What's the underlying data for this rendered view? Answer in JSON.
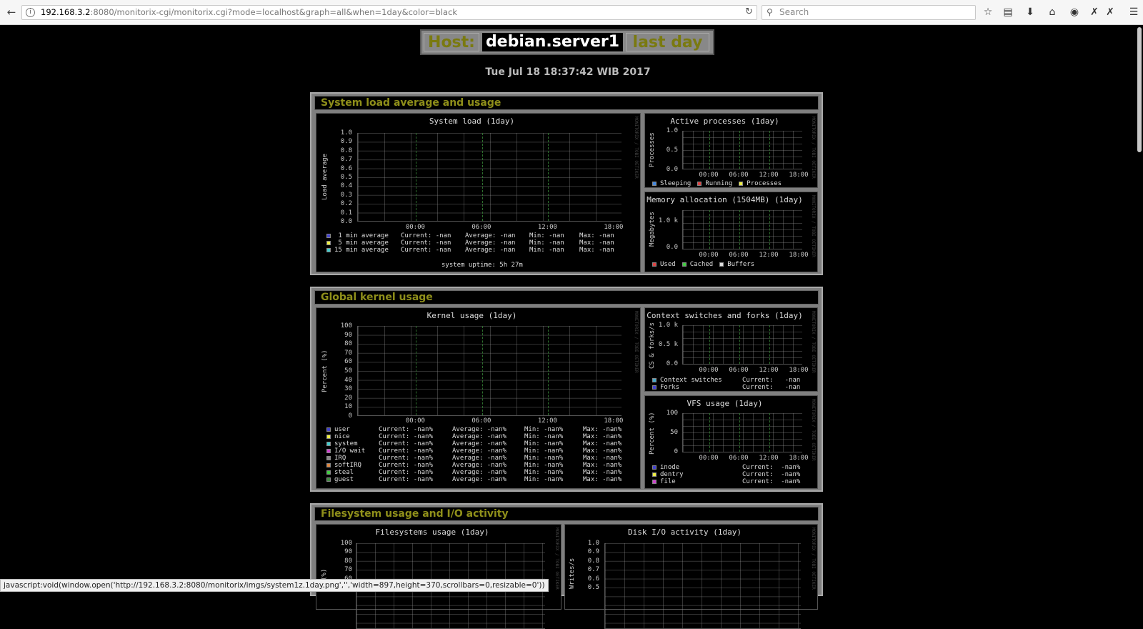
{
  "browser": {
    "url_host": "192.168.3.2",
    "url_rest": ":8080/monitorix-cgi/monitorix.cgi?mode=localhost&graph=all&when=1day&color=black",
    "search_placeholder": "Search"
  },
  "header": {
    "host_label": "Host:",
    "host_name": "debian.server1",
    "period": "last day",
    "datetime": "Tue Jul 18 18:37:42 WIB 2017"
  },
  "sections": [
    {
      "title": "System load average and usage"
    },
    {
      "title": "Global kernel usage"
    },
    {
      "title": "Filesystem usage and I/O activity"
    }
  ],
  "side_tag": "MONITORIX / TOBI OETIKER",
  "x_ticks": [
    "00:00",
    "06:00",
    "12:00",
    "18:00"
  ],
  "graphs": {
    "system_load": {
      "title": "System load  (1day)",
      "ylabel": "Load average",
      "yticks": [
        "1.0",
        "0.9",
        "0.8",
        "0.7",
        "0.6",
        "0.5",
        "0.4",
        "0.3",
        "0.2",
        "0.1",
        "0.0"
      ],
      "legend": [
        {
          "name": " 1 min average",
          "current": "Current: -nan",
          "average": "Average: -nan",
          "min": "Min: -nan",
          "max": "Max: -nan",
          "color": "#4444cc"
        },
        {
          "name": " 5 min average",
          "current": "Current: -nan",
          "average": "Average: -nan",
          "min": "Min: -nan",
          "max": "Max: -nan",
          "color": "#eeee44"
        },
        {
          "name": "15 min average",
          "current": "Current: -nan",
          "average": "Average: -nan",
          "min": "Min: -nan",
          "max": "Max: -nan",
          "color": "#44cccc"
        }
      ],
      "uptime": "system uptime:  5h 27m"
    },
    "active_processes": {
      "title": "Active processes  (1day)",
      "ylabel": "Processes",
      "yticks": [
        "1.0",
        "0.5",
        "0.0"
      ],
      "legend": [
        {
          "name": "Sleeping",
          "color": "#4488dd"
        },
        {
          "name": "Running",
          "color": "#dd4444"
        },
        {
          "name": "Processes",
          "color": "#eeee44"
        }
      ]
    },
    "memory": {
      "title": "Memory allocation (1504MB)  (1day)",
      "ylabel": "Megabytes",
      "yticks": [
        "1.0 k",
        "0.0"
      ],
      "legend": [
        {
          "name": "Used",
          "color": "#dd4444"
        },
        {
          "name": "Cached",
          "color": "#44cc44"
        },
        {
          "name": "Buffers",
          "color": "#dddddd"
        }
      ]
    },
    "kernel": {
      "title": "Kernel usage  (1day)",
      "ylabel": "Percent (%)",
      "yticks": [
        "100",
        "90",
        "80",
        "70",
        "60",
        "50",
        "40",
        "30",
        "20",
        "10",
        "0"
      ],
      "legend": [
        {
          "name": "user",
          "current": "Current: -nan%",
          "average": "Average: -nan%",
          "min": "Min: -nan%",
          "max": "Max: -nan%",
          "color": "#4444cc"
        },
        {
          "name": "nice",
          "current": "Current: -nan%",
          "average": "Average: -nan%",
          "min": "Min: -nan%",
          "max": "Max: -nan%",
          "color": "#eeee44"
        },
        {
          "name": "system",
          "current": "Current: -nan%",
          "average": "Average: -nan%",
          "min": "Min: -nan%",
          "max": "Max: -nan%",
          "color": "#44cccc"
        },
        {
          "name": "I/O wait",
          "current": "Current: -nan%",
          "average": "Average: -nan%",
          "min": "Min: -nan%",
          "max": "Max: -nan%",
          "color": "#cc44cc"
        },
        {
          "name": "IRQ",
          "current": "Current: -nan%",
          "average": "Average: -nan%",
          "min": "Min: -nan%",
          "max": "Max: -nan%",
          "color": "#888888"
        },
        {
          "name": "softIRQ",
          "current": "Current: -nan%",
          "average": "Average: -nan%",
          "min": "Min: -nan%",
          "max": "Max: -nan%",
          "color": "#dd8844"
        },
        {
          "name": "steal",
          "current": "Current: -nan%",
          "average": "Average: -nan%",
          "min": "Min: -nan%",
          "max": "Max: -nan%",
          "color": "#44cc44"
        },
        {
          "name": "guest",
          "current": "Current: -nan%",
          "average": "Average: -nan%",
          "min": "Min: -nan%",
          "max": "Max: -nan%",
          "color": "#448844"
        }
      ]
    },
    "context": {
      "title": "Context switches and forks  (1day)",
      "ylabel": "CS & forks/s",
      "yticks": [
        "1.0 k",
        "0.5 k",
        "0.0"
      ],
      "legend": [
        {
          "name": "Context switches",
          "current": "Current:   -nan",
          "color": "#44aacc"
        },
        {
          "name": "Forks",
          "current": "Current:   -nan",
          "color": "#4444cc"
        }
      ]
    },
    "vfs": {
      "title": "VFS usage  (1day)",
      "ylabel": "Percent (%)",
      "yticks": [
        "100",
        "50",
        "0"
      ],
      "legend": [
        {
          "name": "inode",
          "current": "Current:  -nan%",
          "color": "#4444cc"
        },
        {
          "name": "dentry",
          "current": "Current:  -nan%",
          "color": "#eeee44"
        },
        {
          "name": "file",
          "current": "Current:  -nan%",
          "color": "#cc44cc"
        }
      ]
    },
    "filesystems": {
      "title": "Filesystems usage  (1day)",
      "ylabel": "(%)",
      "yticks": [
        "100",
        "90",
        "80",
        "70",
        "60"
      ]
    },
    "disk_io": {
      "title": "Disk I/O activity  (1day)",
      "ylabel": "Writes/s",
      "yticks": [
        "1.0",
        "0.9",
        "0.8",
        "0.7",
        "0.6",
        "0.5"
      ]
    }
  },
  "statusbar": "javascript:void(window.open('http://192.168.3.2:8080/monitorix/imgs/system1z.1day.png','','width=897,height=370,scrollbars=0,resizable=0'))"
}
